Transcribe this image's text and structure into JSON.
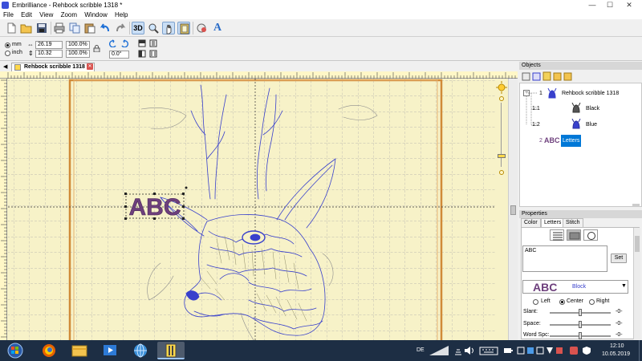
{
  "window": {
    "title": "Embrilliance - Rehbock scribble 1318 *",
    "controls": {
      "minimize": "—",
      "maximize": "☐",
      "close": "✕"
    }
  },
  "menu": [
    "File",
    "Edit",
    "View",
    "Zoom",
    "Window",
    "Help"
  ],
  "toolbar": {
    "buttons": [
      "new-icon",
      "open-icon",
      "save-icon",
      "print-icon",
      "copy-icon",
      "paste-icon",
      "undo-icon",
      "redo-icon",
      "3d-icon",
      "zoom-icon",
      "hand-icon",
      "frame-icon",
      "add-stitch-icon",
      "text-icon"
    ],
    "three_d_label": "3D",
    "text_tool_label": "A"
  },
  "dimensions": {
    "unit_mm": "mm",
    "unit_inch": "inch",
    "selected_unit": "mm",
    "width": "26.19",
    "height": "10.32",
    "width_pct": "100.0%",
    "height_pct": "100.0%",
    "rotation": "0.0°"
  },
  "document_tab": {
    "label": "Rehbock scribble 1318 *"
  },
  "canvas": {
    "letters_text": "ABC",
    "letters_color": "#6d3f7c",
    "thread_color": "#3840cc",
    "hoop_color": "#d08a38",
    "grid_color": "#a9a9a9"
  },
  "objects": {
    "header": "Objects",
    "tree": [
      {
        "index": "1",
        "label": "Rehbock scribble 1318"
      },
      {
        "index": "1:1",
        "label": "Black"
      },
      {
        "index": "1:2",
        "label": "Blue"
      },
      {
        "index": "2",
        "icon_text": "ABC",
        "label": "Letters"
      }
    ]
  },
  "properties": {
    "header": "Properties",
    "tabs": [
      "Color",
      "Letters",
      "Stitch"
    ],
    "active_tab": "Letters",
    "text_value": "ABC",
    "set_button": "Set",
    "font_preview": "ABC",
    "font_name": "Block",
    "align": {
      "left": "Left",
      "center": "Center",
      "right": "Right",
      "selected": "Center"
    },
    "slant_label": "Slant:",
    "slant_value": "-0-",
    "space_label": "Space:",
    "space_value": "-0-",
    "word_spc_label": "Word Spc:",
    "word_spc_value": "-0-"
  },
  "taskbar": {
    "apps": [
      "windows-start-icon",
      "firefox-icon",
      "file-explorer-icon",
      "media-player-icon",
      "globe-app-icon",
      "embrilliance-icon"
    ],
    "language": "DE",
    "time": "12:10",
    "date": "10.05.2019"
  }
}
